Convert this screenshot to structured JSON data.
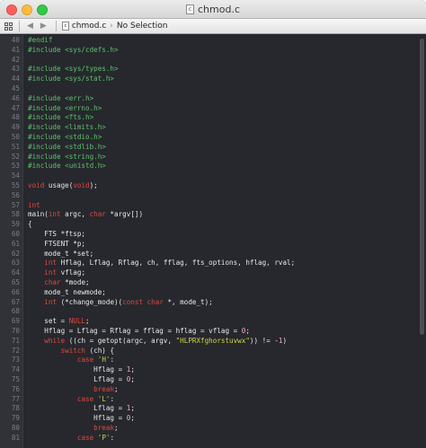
{
  "window": {
    "title": "chmod.c",
    "title_icon": "c-source-file-icon"
  },
  "jumpbar": {
    "file": "chmod.c",
    "selection": "No Selection"
  },
  "editor": {
    "lines": [
      {
        "n": "40",
        "t": [
          [
            "pp",
            "#endif"
          ]
        ]
      },
      {
        "n": "41",
        "t": [
          [
            "pp",
            "#include <sys/cdefs.h>"
          ]
        ]
      },
      {
        "n": "42",
        "t": []
      },
      {
        "n": "43",
        "t": [
          [
            "pp",
            "#include <sys/types.h>"
          ]
        ]
      },
      {
        "n": "44",
        "t": [
          [
            "pp",
            "#include <sys/stat.h>"
          ]
        ]
      },
      {
        "n": "45",
        "t": []
      },
      {
        "n": "46",
        "t": [
          [
            "pp",
            "#include <err.h>"
          ]
        ]
      },
      {
        "n": "47",
        "t": [
          [
            "pp",
            "#include <errno.h>"
          ]
        ]
      },
      {
        "n": "48",
        "t": [
          [
            "pp",
            "#include <fts.h>"
          ]
        ]
      },
      {
        "n": "49",
        "t": [
          [
            "pp",
            "#include <limits.h>"
          ]
        ]
      },
      {
        "n": "50",
        "t": [
          [
            "pp",
            "#include <stdio.h>"
          ]
        ]
      },
      {
        "n": "51",
        "t": [
          [
            "pp",
            "#include <stdlib.h>"
          ]
        ]
      },
      {
        "n": "52",
        "t": [
          [
            "pp",
            "#include <string.h>"
          ]
        ]
      },
      {
        "n": "53",
        "t": [
          [
            "pp",
            "#include <unistd.h>"
          ]
        ]
      },
      {
        "n": "54",
        "t": []
      },
      {
        "n": "55",
        "t": [
          [
            "kw",
            "void"
          ],
          [
            "",
            " usage("
          ],
          [
            "kw",
            "void"
          ],
          [
            "",
            ");"
          ]
        ]
      },
      {
        "n": "56",
        "t": []
      },
      {
        "n": "57",
        "t": [
          [
            "kw",
            "int"
          ]
        ]
      },
      {
        "n": "58",
        "t": [
          [
            "",
            "main("
          ],
          [
            "kw",
            "int"
          ],
          [
            "",
            " argc, "
          ],
          [
            "kw",
            "char"
          ],
          [
            "",
            " *argv[])"
          ]
        ]
      },
      {
        "n": "59",
        "t": [
          [
            "",
            "{"
          ]
        ]
      },
      {
        "n": "60",
        "t": [
          [
            "",
            "    FTS *ftsp;"
          ]
        ]
      },
      {
        "n": "61",
        "t": [
          [
            "",
            "    FTSENT *p;"
          ]
        ]
      },
      {
        "n": "62",
        "t": [
          [
            "",
            "    mode_t *set;"
          ]
        ]
      },
      {
        "n": "63",
        "t": [
          [
            "",
            "    "
          ],
          [
            "kw",
            "int"
          ],
          [
            "",
            " Hflag, Lflag, Rflag, ch, fflag, fts_options, hflag, rval;"
          ]
        ]
      },
      {
        "n": "64",
        "t": [
          [
            "",
            "    "
          ],
          [
            "kw",
            "int"
          ],
          [
            "",
            " vflag;"
          ]
        ]
      },
      {
        "n": "65",
        "t": [
          [
            "",
            "    "
          ],
          [
            "kw",
            "char"
          ],
          [
            "",
            " *mode;"
          ]
        ]
      },
      {
        "n": "66",
        "t": [
          [
            "",
            "    mode_t newmode;"
          ]
        ]
      },
      {
        "n": "67",
        "t": [
          [
            "",
            "    "
          ],
          [
            "kw",
            "int"
          ],
          [
            "",
            " (*change_mode)("
          ],
          [
            "kw",
            "const char"
          ],
          [
            "",
            " *, mode_t);"
          ]
        ]
      },
      {
        "n": "68",
        "t": []
      },
      {
        "n": "69",
        "t": [
          [
            "",
            "    set = "
          ],
          [
            "kw",
            "NULL"
          ],
          [
            "",
            ";"
          ]
        ]
      },
      {
        "n": "70",
        "t": [
          [
            "",
            "    Hflag = Lflag = Rflag = fflag = hflag = vflag = "
          ],
          [
            "num",
            "0"
          ],
          [
            "",
            ";"
          ]
        ]
      },
      {
        "n": "71",
        "t": [
          [
            "",
            "    "
          ],
          [
            "kw",
            "while"
          ],
          [
            "",
            " ((ch = getopt(argc, argv, "
          ],
          [
            "str",
            "\"HLPRXfghorstuvwx\""
          ],
          [
            "",
            ")) != -"
          ],
          [
            "num",
            "1"
          ],
          [
            "",
            ")"
          ]
        ]
      },
      {
        "n": "72",
        "t": [
          [
            "",
            "        "
          ],
          [
            "kw",
            "switch"
          ],
          [
            "",
            " (ch) {"
          ]
        ]
      },
      {
        "n": "73",
        "t": [
          [
            "",
            "            "
          ],
          [
            "kw",
            "case"
          ],
          [
            "",
            " "
          ],
          [
            "str",
            "'H'"
          ],
          [
            "",
            ":"
          ]
        ]
      },
      {
        "n": "74",
        "t": [
          [
            "",
            "                Hflag = "
          ],
          [
            "num",
            "1"
          ],
          [
            "",
            ";"
          ]
        ]
      },
      {
        "n": "75",
        "t": [
          [
            "",
            "                Lflag = "
          ],
          [
            "num",
            "0"
          ],
          [
            "",
            ";"
          ]
        ]
      },
      {
        "n": "76",
        "t": [
          [
            "",
            "                "
          ],
          [
            "kw",
            "break"
          ],
          [
            "",
            ";"
          ]
        ]
      },
      {
        "n": "77",
        "t": [
          [
            "",
            "            "
          ],
          [
            "kw",
            "case"
          ],
          [
            "",
            " "
          ],
          [
            "str",
            "'L'"
          ],
          [
            "",
            ":"
          ]
        ]
      },
      {
        "n": "78",
        "t": [
          [
            "",
            "                Lflag = "
          ],
          [
            "num",
            "1"
          ],
          [
            "",
            ";"
          ]
        ]
      },
      {
        "n": "79",
        "t": [
          [
            "",
            "                Hflag = "
          ],
          [
            "num",
            "0"
          ],
          [
            "",
            ";"
          ]
        ]
      },
      {
        "n": "80",
        "t": [
          [
            "",
            "                "
          ],
          [
            "kw",
            "break"
          ],
          [
            "",
            ";"
          ]
        ]
      },
      {
        "n": "81",
        "t": [
          [
            "",
            "            "
          ],
          [
            "kw",
            "case"
          ],
          [
            "",
            " "
          ],
          [
            "str",
            "'P'"
          ],
          [
            "",
            ":"
          ]
        ]
      }
    ]
  },
  "colors": {
    "background": "#26282d",
    "preprocessor": "#5ec26a",
    "keyword": "#e0483e",
    "string": "#d4d44a",
    "number": "#f4a7c8"
  }
}
